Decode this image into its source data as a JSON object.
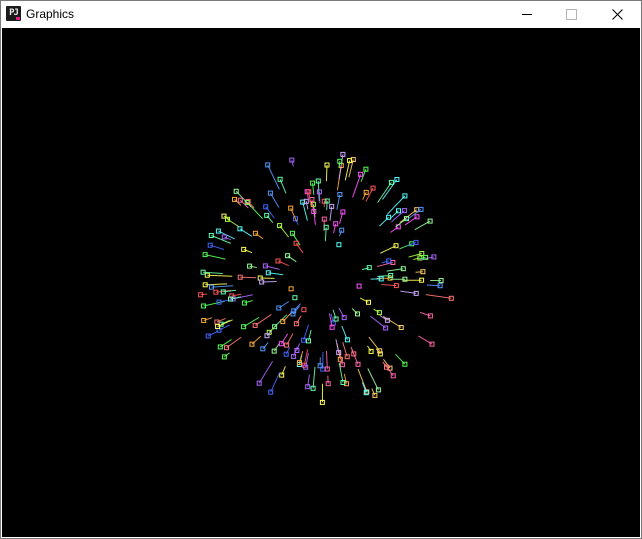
{
  "window": {
    "title": "Graphics",
    "icon": "processing-app-icon",
    "icon_label": "PJ"
  },
  "controls": {
    "minimize": "minimize-icon",
    "maximize": "maximize-icon",
    "close": "close-icon"
  },
  "canvas": {
    "background": "#000000",
    "scene": "firework-burst",
    "particle_colors": [
      "#ff5555",
      "#55ff55",
      "#5599ff",
      "#ff55ff",
      "#ffff55",
      "#55ffff",
      "#ffaa33",
      "#aa66ff",
      "#66ffaa",
      "#ff66aa",
      "#aaff44",
      "#4466ff",
      "#ff7777",
      "#99ff99",
      "#ccaaff",
      "#ffcc66"
    ]
  }
}
